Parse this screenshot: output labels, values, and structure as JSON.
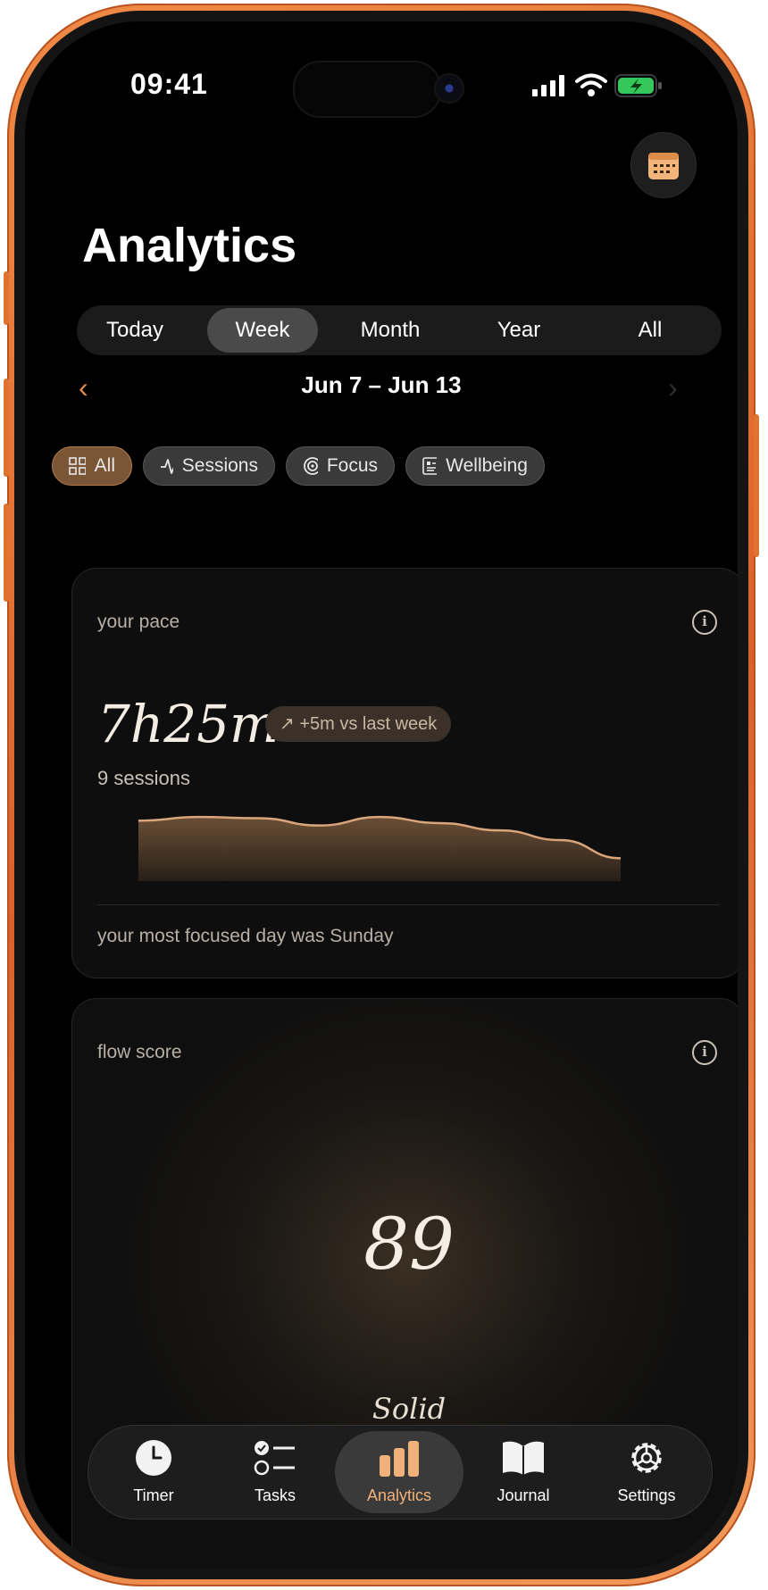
{
  "status_bar": {
    "time": "09:41"
  },
  "header": {
    "title": "Analytics",
    "calendar_icon": "calendar-icon"
  },
  "period_tabs": [
    {
      "label": "Today"
    },
    {
      "label": "Week",
      "active": true
    },
    {
      "label": "Month"
    },
    {
      "label": "Year"
    },
    {
      "label": "All"
    }
  ],
  "date_range": {
    "label": "Jun 7 – Jun 13",
    "prev": "‹",
    "next": "›"
  },
  "filters": [
    {
      "label": "All",
      "icon": "grid-icon",
      "active": true
    },
    {
      "label": "Sessions",
      "icon": "pulse-icon"
    },
    {
      "label": "Focus",
      "icon": "target-icon"
    },
    {
      "label": "Wellbeing",
      "icon": "journal-icon"
    }
  ],
  "pace_card": {
    "label": "your pace",
    "total": "7h25m",
    "delta": "↗ +5m vs last week",
    "sessions": "9 sessions",
    "footer": "your most focused day was Sunday",
    "sparkline": [
      0.82,
      0.88,
      0.86,
      0.74,
      0.88,
      0.78,
      0.66,
      0.5,
      0.2
    ]
  },
  "flow_card": {
    "label": "flow score",
    "score": "89",
    "rating": "Solid"
  },
  "tab_bar": [
    {
      "label": "Timer",
      "icon": "clock-icon"
    },
    {
      "label": "Tasks",
      "icon": "checklist-icon"
    },
    {
      "label": "Analytics",
      "icon": "bar-chart-icon",
      "active": true
    },
    {
      "label": "Journal",
      "icon": "book-icon"
    },
    {
      "label": "Settings",
      "icon": "gear-icon"
    }
  ],
  "colors": {
    "accent": "#f0b27a",
    "frame": "#e0732f",
    "background": "#000000"
  }
}
